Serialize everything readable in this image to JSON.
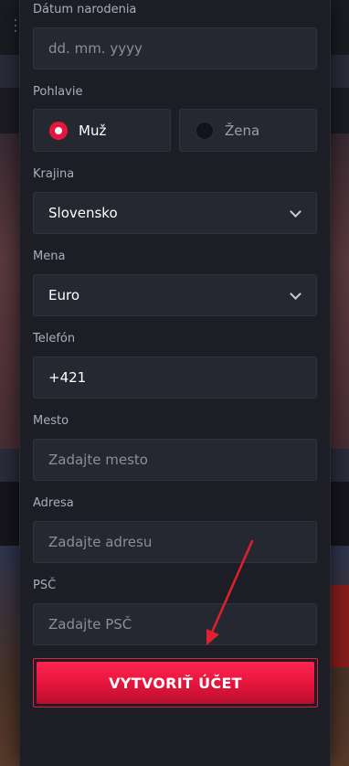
{
  "form": {
    "birthdate": {
      "label": "Dátum narodenia",
      "placeholder": "dd. mm. yyyy"
    },
    "gender": {
      "label": "Pohlavie",
      "options": [
        "Muž",
        "Žena"
      ],
      "selected": "Muž"
    },
    "country": {
      "label": "Krajina",
      "value": "Slovensko"
    },
    "currency": {
      "label": "Mena",
      "value": "Euro"
    },
    "phone": {
      "label": "Telefón",
      "value": "+421"
    },
    "city": {
      "label": "Mesto",
      "placeholder": "Zadajte mesto"
    },
    "address": {
      "label": "Adresa",
      "placeholder": "Zadajte adresu"
    },
    "zip": {
      "label": "PSČ",
      "placeholder": "Zadajte PSČ"
    },
    "submit_label": "VYTVORIŤ ÚČET"
  },
  "colors": {
    "accent": "#e5173f",
    "arrow": "#e0202c",
    "field_bg": "#262831"
  },
  "icons": {
    "dropdown": "chevron-down-icon",
    "menu": "menu-dots-icon",
    "annotation": "red-arrow"
  }
}
